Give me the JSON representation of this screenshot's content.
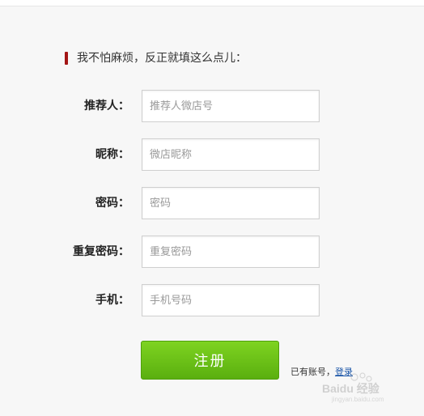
{
  "section_title": "我不怕麻烦，反正就填这么点儿：",
  "fields": [
    {
      "label": "推荐人：",
      "placeholder": "推荐人微店号",
      "value": ""
    },
    {
      "label": "昵称：",
      "placeholder": "微店昵称",
      "value": ""
    },
    {
      "label": "密码：",
      "placeholder": "密码",
      "value": ""
    },
    {
      "label": "重复密码：",
      "placeholder": "重复密码",
      "value": ""
    },
    {
      "label": "手机：",
      "placeholder": "手机号码",
      "value": ""
    }
  ],
  "submit_label": "注册",
  "login": {
    "prompt": "已有账号，",
    "link_label": "登录"
  },
  "colors": {
    "accent_bar": "#a31515",
    "submit_green": "#6cc31a",
    "link_blue": "#1a55a8"
  },
  "watermark": {
    "text": "Baidu 经验",
    "subtext": "jingyan.baidu.com"
  }
}
